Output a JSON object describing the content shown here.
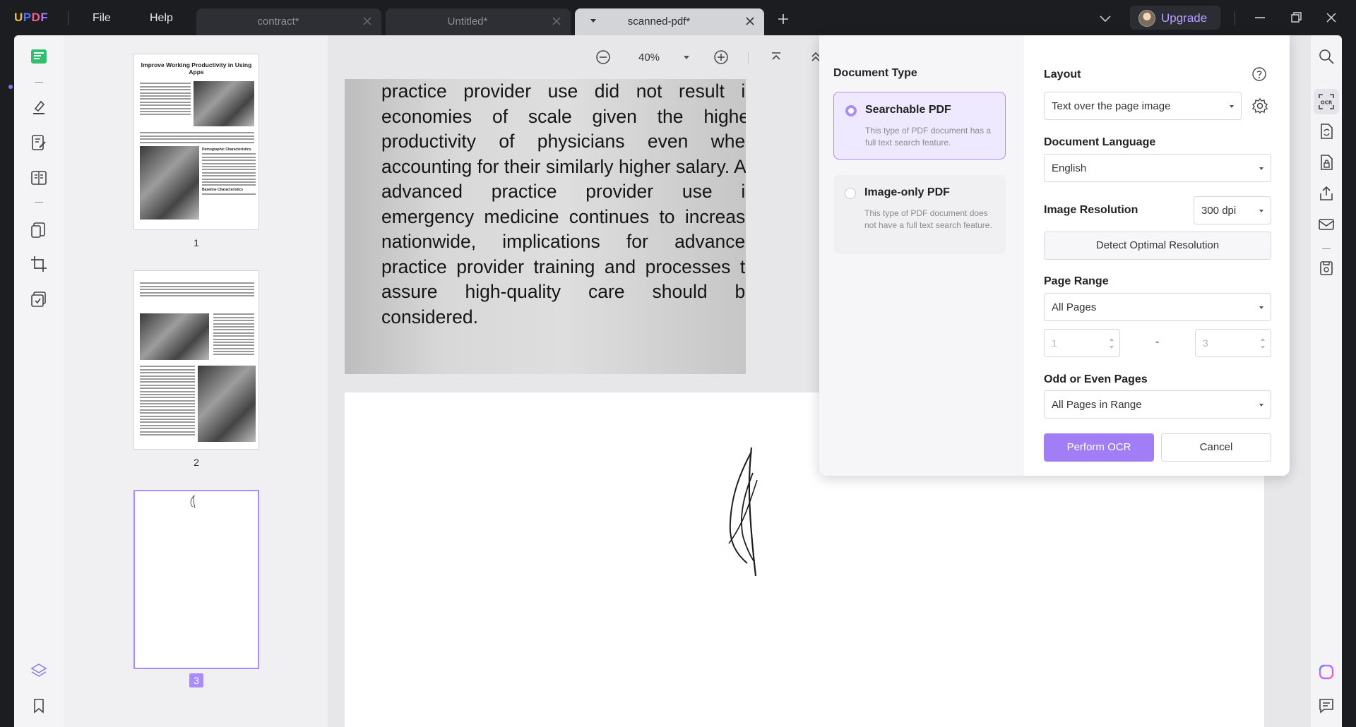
{
  "app": {
    "logo_text": "UPDF",
    "menu": {
      "file": "File",
      "help": "Help"
    },
    "upgrade_label": "Upgrade"
  },
  "tabs": [
    {
      "label": "contract*",
      "active": false
    },
    {
      "label": "Untitled*",
      "active": false
    },
    {
      "label": "scanned-pdf*",
      "active": true
    }
  ],
  "toolbar": {
    "zoom": "40%"
  },
  "thumbnails": {
    "pages": [
      {
        "number": "1",
        "title": "Improve Working Productivity in Using Apps",
        "heading_a": "Demographic Characteristics",
        "heading_b": "Baseline Characteristics"
      },
      {
        "number": "2"
      },
      {
        "number": "3"
      }
    ]
  },
  "document": {
    "text": "practice provider use did not result in economies of scale given the higher productivity of physicians even when accounting for their similarly higher salary. As advanced practice provider use in emergency medicine continues to increase nationwide, implications for advanced practice provider training and processes to assure high-quality care should be considered."
  },
  "ocr": {
    "document_type_title": "Document Type",
    "options": [
      {
        "title": "Searchable PDF",
        "desc": "This type of PDF document has a full text search feature.",
        "selected": true
      },
      {
        "title": "Image-only PDF",
        "desc": "This type of PDF document does not have a full text search feature.",
        "selected": false
      }
    ],
    "layout_label": "Layout",
    "layout_value": "Text over the page image",
    "language_label": "Document Language",
    "language_value": "English",
    "resolution_label": "Image Resolution",
    "resolution_value": "300 dpi",
    "detect_button": "Detect Optimal Resolution",
    "page_range_label": "Page Range",
    "page_range_value": "All Pages",
    "range_from": "1",
    "range_to": "3",
    "range_dash": "-",
    "odd_even_label": "Odd or Even Pages",
    "odd_even_value": "All Pages in Range",
    "perform_button": "Perform OCR",
    "cancel_button": "Cancel"
  },
  "colors": {
    "accent": "#a17ef5",
    "accent_light": "#a98cff",
    "titlebar": "#1c1d21"
  }
}
